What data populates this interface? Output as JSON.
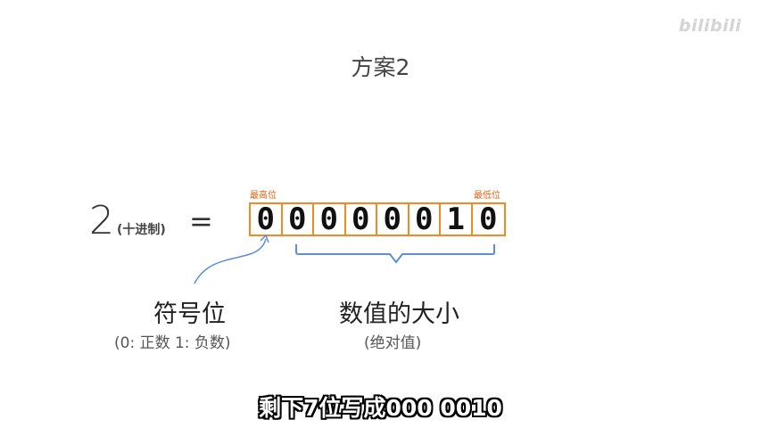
{
  "watermark": "bilibili",
  "title": "方案2",
  "decimal": {
    "number": "2",
    "note": "(十进制)",
    "equals": "="
  },
  "labels": {
    "msb": "最高位",
    "lsb": "最低位"
  },
  "bits": [
    "0",
    "0",
    "0",
    "0",
    "0",
    "0",
    "1",
    "0"
  ],
  "sign": {
    "title": "符号位",
    "note": "(0: 正数  1: 负数)"
  },
  "magnitude": {
    "title": "数值的大小",
    "note": "(绝对值)"
  },
  "subtitle": "剩下7位写成000 0010",
  "colors": {
    "box": "#f08a24",
    "brace": "#5b8fd6",
    "arrow": "#5b8fd6",
    "label": "#e06010"
  }
}
